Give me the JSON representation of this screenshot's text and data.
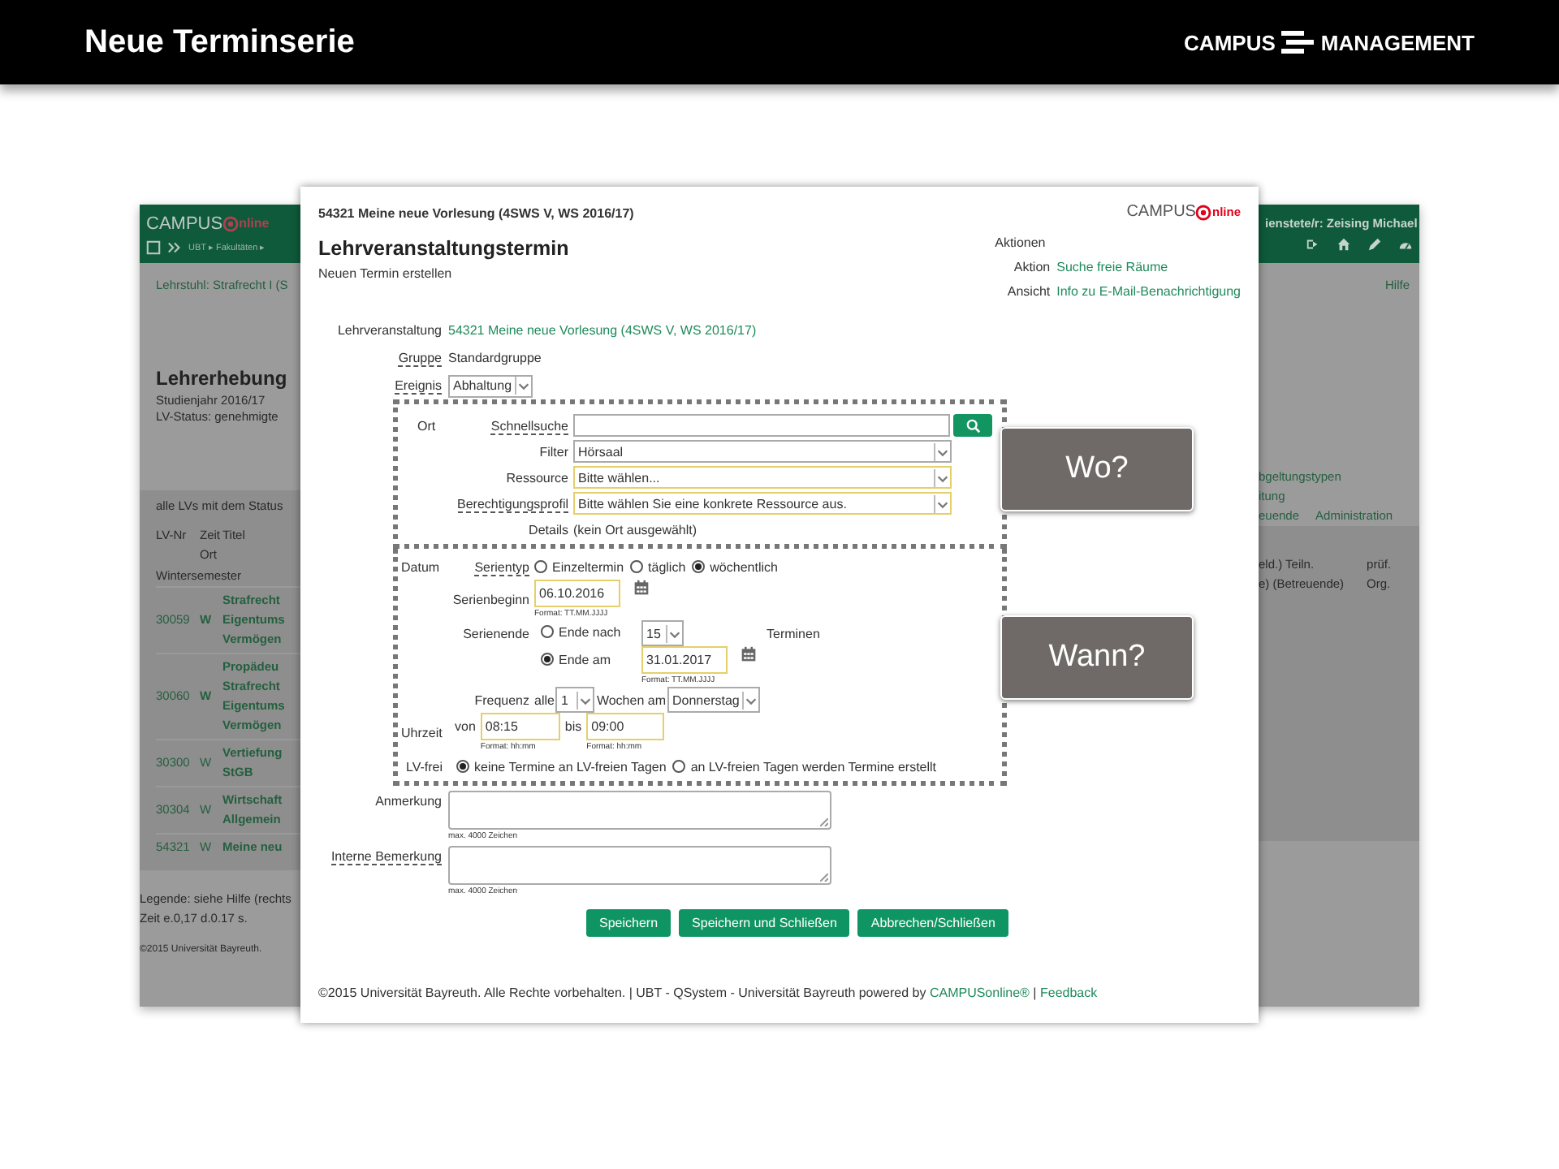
{
  "slide": {
    "title": "Neue Terminserie",
    "logo_left": "CAMPUS",
    "logo_right": "MANAGEMENT"
  },
  "background_app": {
    "logo_left": "CAMPUS",
    "logo_right": "nline",
    "breadcrumb": "UBT ▸ Fakultäten ▸",
    "user": "ienstete/r: Zeising Michael",
    "org_link": "Lehrstuhl: Strafrecht I (S",
    "help": "Hilfe",
    "heading": "Lehrerhebung",
    "subtitle_lines": [
      "Studienjahr 2016/17",
      "LV-Status: genehmigte"
    ],
    "right_links": [
      "bgeltungstypen",
      "itung"
    ],
    "right_links_row": [
      "euende",
      "Administration"
    ],
    "table_caption": "alle LVs mit dem Status",
    "columns": [
      "LV-Nr",
      "Zeit",
      "Titel"
    ],
    "column_sub": "Ort",
    "columns_right": [
      [
        "eld.) Teiln.",
        "e) (Betreuende)"
      ],
      [
        "prüf.",
        "Org."
      ]
    ],
    "group": "Wintersemester",
    "rows": [
      {
        "nr": "30059",
        "zeit": "W",
        "zeit_bold": true,
        "title_lines": [
          "Strafrecht",
          "Eigentums",
          "Vermögen"
        ]
      },
      {
        "nr": "30060",
        "zeit": "W",
        "zeit_bold": true,
        "title_lines": [
          "Propädeu",
          "Strafrecht",
          "Eigentums",
          "Vermögen"
        ]
      },
      {
        "nr": "30300",
        "zeit": "W",
        "zeit_bold": false,
        "title_lines": [
          "Vertiefung",
          "StGB"
        ]
      },
      {
        "nr": "30304",
        "zeit": "W",
        "zeit_bold": false,
        "title_lines": [
          "Wirtschaft",
          "Allgemein"
        ]
      },
      {
        "nr": "54321",
        "zeit": "W",
        "zeit_bold": false,
        "title_lines": [
          "Meine neu"
        ]
      }
    ],
    "legend": "Legende: siehe Hilfe (rechts",
    "timing": "Zeit e.0,17 d.0.17 s.",
    "copyright": "©2015 Universität Bayreuth."
  },
  "dialog": {
    "course_title": "54321 Meine neue Vorlesung (4SWS V, WS 2016/17)",
    "logo_left": "CAMPUS",
    "logo_right": "nline",
    "heading": "Lehrveranstaltungstermin",
    "subheading": "Neuen Termin erstellen",
    "actions": {
      "title": "Aktionen",
      "rows": [
        {
          "label": "Aktion",
          "link": "Suche freie Räume"
        },
        {
          "label": "Ansicht",
          "link": "Info zu E-Mail-Benachrichtigung"
        }
      ]
    },
    "course": {
      "label": {
        "text": "Lehrveranstaltung",
        "help": false
      },
      "link": "54321 Meine neue Vorlesung (4SWS V, WS 2016/17)"
    },
    "group": {
      "label": {
        "text": "Gruppe",
        "help": true
      },
      "value": "Standardgruppe"
    },
    "event": {
      "label": {
        "text": "Ereignis",
        "help": true
      },
      "value": "Abhaltung"
    },
    "where": {
      "section": "Ort",
      "callout": "Wo?",
      "quick_search": {
        "label": {
          "text": "Schnellsuche",
          "help": true
        }
      },
      "selects": [
        {
          "label": {
            "text": "Filter",
            "help": false
          },
          "value": "Hörsaal",
          "required": false
        },
        {
          "label": {
            "text": "Ressource",
            "help": false
          },
          "value": "Bitte wählen...",
          "required": true
        },
        {
          "label": {
            "text": "Berechtigungsprofil",
            "help": true
          },
          "value": "Bitte wählen Sie eine konkrete Ressource aus.",
          "required": true
        }
      ],
      "details": {
        "label": "Details",
        "value": "(kein Ort ausgewählt)"
      }
    },
    "when": {
      "section": "Datum",
      "callout": "Wann?",
      "series_type": {
        "label": {
          "text": "Serientyp",
          "help": true
        },
        "options": [
          {
            "label": "Einzeltermin",
            "selected": false
          },
          {
            "label": "täglich",
            "selected": false
          },
          {
            "label": "wöchentlich",
            "selected": true
          }
        ]
      },
      "start": {
        "label": "Serienbeginn",
        "value": "06.10.2016",
        "format": "Format: TT.MM.JJJJ"
      },
      "end": {
        "label": "Serienende",
        "after": {
          "label": "Ende nach",
          "selected": false,
          "count": "15",
          "unit": "Terminen"
        },
        "on": {
          "label": "Ende am",
          "selected": true,
          "value": "31.01.2017",
          "format": "Format: TT.MM.JJJJ"
        }
      },
      "frequency": {
        "label": "Frequenz",
        "prefix": "alle",
        "value": "1",
        "middle": "Wochen am",
        "weekday": "Donnerstag"
      },
      "time": {
        "section": "Uhrzeit",
        "from_label": "von",
        "from": "08:15",
        "from_format": "Format: hh:mm",
        "to_label": "bis",
        "to": "09:00",
        "to_format": "Format: hh:mm"
      },
      "lv_free": {
        "section": "LV-frei",
        "options": [
          {
            "label": "keine Termine an LV-freien Tagen",
            "selected": true
          },
          {
            "label": "an LV-freien Tagen werden Termine erstellt",
            "selected": false
          }
        ]
      }
    },
    "notes": [
      {
        "label": {
          "text": "Anmerkung",
          "help": false
        },
        "hint": "max. 4000 Zeichen"
      },
      {
        "label": {
          "text": "Interne Bemerkung",
          "help": true
        },
        "hint": "max. 4000 Zeichen"
      }
    ],
    "buttons": [
      "Speichern",
      "Speichern und Schließen",
      "Abbrechen/Schließen"
    ],
    "footer": {
      "text": "©2015 Universität Bayreuth. Alle Rechte vorbehalten. | UBT - QSystem - Universität Bayreuth powered by",
      "link": "CAMPUSonline®",
      "separator": "|",
      "feedback": "Feedback"
    }
  }
}
